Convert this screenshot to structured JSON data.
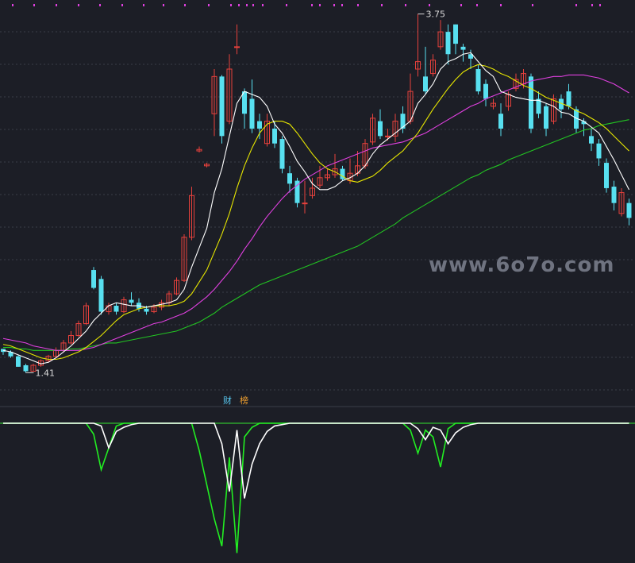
{
  "watermark": "www.6o7o.com",
  "tags": {
    "finance": "财",
    "ranking": "榜"
  },
  "colors": {
    "bg": "#1c1e26",
    "up": "#e8413c",
    "down": "#58e0f0",
    "grid": "#3a3d48",
    "ma5": "#ffffff",
    "ma10": "#e6e600",
    "ma20": "#e040e0",
    "ma60": "#22c422",
    "osc_green": "#22ee22",
    "osc_white": "#ffffff",
    "divider": "#2fbf2f",
    "marker": "#e040e0"
  },
  "chart_data": [
    {
      "type": "candlestick",
      "annotations": {
        "high": "3.75",
        "low": "1.41"
      },
      "ylim": [
        1.3,
        3.85
      ],
      "grid": true,
      "candles": [
        [
          1.57,
          1.55,
          1.57,
          1.53
        ],
        [
          1.55,
          1.52,
          1.56,
          1.51
        ],
        [
          1.52,
          1.45,
          1.53,
          1.45
        ],
        [
          1.46,
          1.42,
          1.47,
          1.41
        ],
        [
          1.42,
          1.46,
          1.47,
          1.42
        ],
        [
          1.46,
          1.49,
          1.5,
          1.45
        ],
        [
          1.49,
          1.52,
          1.53,
          1.48
        ],
        [
          1.52,
          1.56,
          1.58,
          1.51
        ],
        [
          1.56,
          1.61,
          1.63,
          1.55
        ],
        [
          1.61,
          1.66,
          1.69,
          1.6
        ],
        [
          1.66,
          1.74,
          1.76,
          1.65
        ],
        [
          1.74,
          1.86,
          1.88,
          1.73
        ],
        [
          2.1,
          1.98,
          2.12,
          1.97
        ],
        [
          2.04,
          1.82,
          2.06,
          1.8
        ],
        [
          1.82,
          1.86,
          1.88,
          1.8
        ],
        [
          1.86,
          1.82,
          1.88,
          1.8
        ],
        [
          1.82,
          1.9,
          1.92,
          1.81
        ],
        [
          1.9,
          1.88,
          1.95,
          1.86
        ],
        [
          1.88,
          1.84,
          1.91,
          1.82
        ],
        [
          1.84,
          1.82,
          1.86,
          1.8
        ],
        [
          1.82,
          1.85,
          1.87,
          1.81
        ],
        [
          1.85,
          1.88,
          1.9,
          1.83
        ],
        [
          1.88,
          1.94,
          1.96,
          1.86
        ],
        [
          1.94,
          2.03,
          2.05,
          1.93
        ],
        [
          2.03,
          2.32,
          2.34,
          2.02
        ],
        [
          2.32,
          2.6,
          2.66,
          2.3
        ],
        [
          2.9,
          2.91,
          2.93,
          2.89
        ],
        [
          2.8,
          2.81,
          2.82,
          2.79
        ],
        [
          3.15,
          3.4,
          3.45,
          3.0
        ],
        [
          3.4,
          3.0,
          3.41,
          2.95
        ],
        [
          3.1,
          3.45,
          3.55,
          3.08
        ],
        [
          3.6,
          3.6,
          3.75,
          3.55
        ],
        [
          3.3,
          3.15,
          3.32,
          3.05
        ],
        [
          3.25,
          3.05,
          3.38,
          3.02
        ],
        [
          3.1,
          3.05,
          3.15,
          2.98
        ],
        [
          2.95,
          3.1,
          3.15,
          2.93
        ],
        [
          3.05,
          2.95,
          3.1,
          2.92
        ],
        [
          2.98,
          2.78,
          3.0,
          2.75
        ],
        [
          2.75,
          2.68,
          2.8,
          2.62
        ],
        [
          2.7,
          2.55,
          2.72,
          2.52
        ],
        [
          2.55,
          2.55,
          2.7,
          2.48
        ],
        [
          2.6,
          2.65,
          2.72,
          2.58
        ],
        [
          2.67,
          2.72,
          2.8,
          2.65
        ],
        [
          2.72,
          2.74,
          2.78,
          2.7
        ],
        [
          2.74,
          2.78,
          2.88,
          2.72
        ],
        [
          2.78,
          2.71,
          2.8,
          2.7
        ],
        [
          2.7,
          2.75,
          2.85,
          2.68
        ],
        [
          2.75,
          2.8,
          2.9,
          2.73
        ],
        [
          2.8,
          2.95,
          2.98,
          2.78
        ],
        [
          2.96,
          3.12,
          3.15,
          2.94
        ],
        [
          3.1,
          3.0,
          3.18,
          2.98
        ],
        [
          3.0,
          3.0,
          3.05,
          2.97
        ],
        [
          3.0,
          3.1,
          3.15,
          2.96
        ],
        [
          3.15,
          3.05,
          3.2,
          3.02
        ],
        [
          3.1,
          3.3,
          3.42,
          3.08
        ],
        [
          3.45,
          3.5,
          3.82,
          3.4
        ],
        [
          3.4,
          3.3,
          3.6,
          3.28
        ],
        [
          3.42,
          3.51,
          3.55,
          3.4
        ],
        [
          3.6,
          3.7,
          3.78,
          3.58
        ],
        [
          3.7,
          3.55,
          3.75,
          3.48
        ],
        [
          3.75,
          3.62,
          3.75,
          3.55
        ],
        [
          3.6,
          3.58,
          3.62,
          3.5
        ],
        [
          3.55,
          3.52,
          3.58,
          3.45
        ],
        [
          3.45,
          3.3,
          3.48,
          3.28
        ],
        [
          3.35,
          3.25,
          3.38,
          3.2
        ],
        [
          3.2,
          3.22,
          3.25,
          3.18
        ],
        [
          3.15,
          3.05,
          3.22,
          3.0
        ],
        [
          3.2,
          3.28,
          3.3,
          3.17
        ],
        [
          3.32,
          3.38,
          3.42,
          3.3
        ],
        [
          3.35,
          3.42,
          3.45,
          3.32
        ],
        [
          3.4,
          3.05,
          3.42,
          3.02
        ],
        [
          3.25,
          3.15,
          3.3,
          3.12
        ],
        [
          3.2,
          3.05,
          3.22,
          3.0
        ],
        [
          3.1,
          3.25,
          3.28,
          3.08
        ],
        [
          3.25,
          3.18,
          3.28,
          3.12
        ],
        [
          3.3,
          3.2,
          3.35,
          3.18
        ],
        [
          3.18,
          3.05,
          3.2,
          3.02
        ],
        [
          3.1,
          3.08,
          3.12,
          3.0
        ],
        [
          3.0,
          2.95,
          3.05,
          2.9
        ],
        [
          2.95,
          2.85,
          2.98,
          2.8
        ],
        [
          2.82,
          2.65,
          2.85,
          2.62
        ],
        [
          2.66,
          2.55,
          2.7,
          2.5
        ],
        [
          2.48,
          2.62,
          2.65,
          2.46
        ],
        [
          2.55,
          2.45,
          2.58,
          2.4
        ]
      ],
      "ma5": [
        1.56,
        1.55,
        1.53,
        1.51,
        1.49,
        1.47,
        1.48,
        1.51,
        1.55,
        1.59,
        1.64,
        1.69,
        1.76,
        1.81,
        1.86,
        1.88,
        1.87,
        1.86,
        1.86,
        1.85,
        1.86,
        1.87,
        1.88,
        1.9,
        1.97,
        2.12,
        2.25,
        2.38,
        2.62,
        2.78,
        3.0,
        3.22,
        3.3,
        3.28,
        3.26,
        3.2,
        3.08,
        3.02,
        2.93,
        2.83,
        2.76,
        2.68,
        2.64,
        2.64,
        2.66,
        2.7,
        2.72,
        2.75,
        2.8,
        2.88,
        2.94,
        2.98,
        3.02,
        3.06,
        3.1,
        3.22,
        3.28,
        3.35,
        3.45,
        3.5,
        3.52,
        3.55,
        3.56,
        3.5,
        3.44,
        3.4,
        3.3,
        3.28,
        3.26,
        3.25,
        3.24,
        3.24,
        3.22,
        3.2,
        3.16,
        3.15,
        3.12,
        3.1,
        3.06,
        3.02,
        2.93,
        2.84,
        2.74,
        2.64
      ],
      "ma10": [
        1.6,
        1.59,
        1.57,
        1.55,
        1.53,
        1.51,
        1.5,
        1.5,
        1.51,
        1.53,
        1.55,
        1.58,
        1.62,
        1.66,
        1.71,
        1.76,
        1.8,
        1.82,
        1.84,
        1.85,
        1.86,
        1.86,
        1.86,
        1.87,
        1.89,
        1.94,
        2.02,
        2.1,
        2.22,
        2.34,
        2.48,
        2.65,
        2.8,
        2.92,
        3.02,
        3.08,
        3.1,
        3.1,
        3.08,
        3.02,
        2.95,
        2.88,
        2.82,
        2.78,
        2.76,
        2.73,
        2.7,
        2.69,
        2.71,
        2.73,
        2.77,
        2.82,
        2.86,
        2.9,
        2.96,
        3.02,
        3.1,
        3.18,
        3.25,
        3.32,
        3.38,
        3.43,
        3.46,
        3.48,
        3.47,
        3.45,
        3.42,
        3.4,
        3.37,
        3.34,
        3.32,
        3.29,
        3.26,
        3.24,
        3.22,
        3.2,
        3.17,
        3.15,
        3.12,
        3.09,
        3.05,
        3.0,
        2.95,
        2.9
      ],
      "ma20": [
        1.64,
        1.63,
        1.62,
        1.61,
        1.59,
        1.58,
        1.57,
        1.56,
        1.56,
        1.56,
        1.56,
        1.57,
        1.58,
        1.6,
        1.62,
        1.64,
        1.66,
        1.68,
        1.7,
        1.72,
        1.74,
        1.75,
        1.77,
        1.79,
        1.81,
        1.84,
        1.88,
        1.92,
        1.97,
        2.03,
        2.09,
        2.16,
        2.24,
        2.31,
        2.39,
        2.46,
        2.52,
        2.58,
        2.63,
        2.67,
        2.71,
        2.74,
        2.77,
        2.8,
        2.82,
        2.84,
        2.86,
        2.88,
        2.9,
        2.92,
        2.93,
        2.94,
        2.95,
        2.96,
        2.98,
        3.0,
        3.02,
        3.05,
        3.08,
        3.11,
        3.14,
        3.17,
        3.2,
        3.22,
        3.25,
        3.27,
        3.29,
        3.31,
        3.33,
        3.35,
        3.37,
        3.38,
        3.39,
        3.4,
        3.4,
        3.41,
        3.41,
        3.41,
        3.4,
        3.39,
        3.37,
        3.35,
        3.32,
        3.29
      ],
      "ma60": [
        1.58,
        1.58,
        1.57,
        1.57,
        1.56,
        1.56,
        1.56,
        1.56,
        1.56,
        1.57,
        1.57,
        1.58,
        1.59,
        1.6,
        1.61,
        1.61,
        1.62,
        1.63,
        1.64,
        1.65,
        1.66,
        1.67,
        1.68,
        1.69,
        1.71,
        1.73,
        1.75,
        1.78,
        1.81,
        1.85,
        1.88,
        1.91,
        1.94,
        1.97,
        2.0,
        2.02,
        2.04,
        2.06,
        2.08,
        2.1,
        2.12,
        2.14,
        2.16,
        2.18,
        2.2,
        2.22,
        2.24,
        2.26,
        2.29,
        2.32,
        2.35,
        2.38,
        2.41,
        2.45,
        2.48,
        2.51,
        2.54,
        2.57,
        2.6,
        2.63,
        2.66,
        2.69,
        2.72,
        2.74,
        2.77,
        2.79,
        2.81,
        2.84,
        2.86,
        2.88,
        2.9,
        2.92,
        2.94,
        2.96,
        2.98,
        3.0,
        3.02,
        3.04,
        3.05,
        3.07,
        3.08,
        3.09,
        3.1,
        3.11
      ]
    },
    {
      "type": "line",
      "ylim": [
        -1,
        0
      ],
      "series": [
        {
          "color": "green",
          "values": [
            0,
            0,
            0,
            0,
            0,
            0,
            0,
            0,
            0,
            0,
            0,
            0,
            -0.08,
            -0.34,
            -0.18,
            -0.02,
            0,
            0,
            0,
            0,
            0,
            0,
            0,
            0,
            0,
            0,
            -0.2,
            -0.45,
            -0.7,
            -0.9,
            -0.25,
            -0.95,
            -0.1,
            -0.03,
            0,
            0,
            0,
            0,
            0,
            0,
            0,
            0,
            0,
            0,
            0,
            0,
            0,
            0,
            0,
            0,
            0,
            0,
            0,
            0,
            -0.05,
            -0.22,
            -0.05,
            -0.1,
            -0.32,
            -0.04,
            0,
            0,
            0,
            0,
            0,
            0,
            0,
            0,
            0,
            0,
            0,
            0,
            0,
            0,
            0,
            0,
            0,
            0,
            0,
            0,
            0,
            0,
            0,
            0
          ]
        },
        {
          "color": "white",
          "values": [
            0,
            0,
            0,
            0,
            0,
            0,
            0,
            0,
            0,
            0,
            0,
            0,
            0,
            -0.02,
            -0.18,
            -0.06,
            -0.03,
            -0.01,
            0,
            0,
            0,
            0,
            0,
            0,
            0,
            0,
            0,
            0,
            0,
            -0.15,
            -0.5,
            -0.05,
            -0.55,
            -0.3,
            -0.15,
            -0.06,
            -0.02,
            -0.01,
            0,
            0,
            0,
            0,
            0,
            0,
            0,
            0,
            0,
            0,
            0,
            0,
            0,
            0,
            0,
            0,
            0,
            -0.04,
            -0.12,
            -0.03,
            -0.05,
            -0.15,
            -0.07,
            -0.03,
            -0.01,
            0,
            0,
            0,
            0,
            0,
            0,
            0,
            0,
            0,
            0,
            0,
            0,
            0,
            0,
            0,
            0,
            0,
            0,
            0,
            0,
            0
          ]
        }
      ]
    }
  ]
}
